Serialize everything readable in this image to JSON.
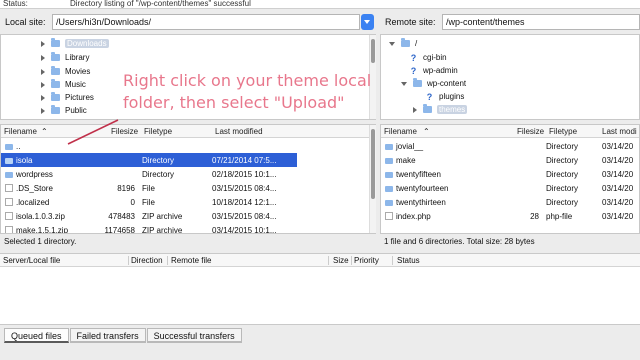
{
  "status": {
    "label": "Status:",
    "message": "Directory listing of \"/wp-content/themes\" successful"
  },
  "local": {
    "label": "Local site:",
    "path": "/Users/hi3n/Downloads/",
    "tree": [
      "Downloads",
      "Library",
      "Movies",
      "Music",
      "Pictures",
      "Public"
    ],
    "columns": [
      "Filename",
      "Filesize",
      "Filetype",
      "Last modified"
    ],
    "rows": [
      {
        "name": "..",
        "size": "",
        "type": "",
        "modified": "",
        "kind": "folder"
      },
      {
        "name": "isola",
        "size": "",
        "type": "Directory",
        "modified": "07/21/2014 07:5...",
        "kind": "folder",
        "selected": true
      },
      {
        "name": "wordpress",
        "size": "",
        "type": "Directory",
        "modified": "02/18/2015 10:1...",
        "kind": "folder"
      },
      {
        "name": ".DS_Store",
        "size": "8196",
        "type": "File",
        "modified": "03/15/2015 08:4...",
        "kind": "file"
      },
      {
        "name": ".localized",
        "size": "0",
        "type": "File",
        "modified": "10/18/2014 12:1...",
        "kind": "file"
      },
      {
        "name": "isola.1.0.3.zip",
        "size": "478483",
        "type": "ZIP archive",
        "modified": "03/15/2015 08:4...",
        "kind": "file"
      },
      {
        "name": "make.1.5.1.zip",
        "size": "1174658",
        "type": "ZIP archive",
        "modified": "03/14/2015 10:1...",
        "kind": "file"
      }
    ],
    "summary": "Selected 1 directory."
  },
  "remote": {
    "label": "Remote site:",
    "path": "/wp-content/themes",
    "tree": [
      "/",
      "cgi-bin",
      "wp-admin",
      "wp-content",
      "plugins",
      "themes"
    ],
    "columns": [
      "Filename",
      "Filesize",
      "Filetype",
      "Last modi"
    ],
    "rows": [
      {
        "name": "jovial__",
        "size": "",
        "type": "Directory",
        "modified": "03/14/20",
        "kind": "folder"
      },
      {
        "name": "make",
        "size": "",
        "type": "Directory",
        "modified": "03/14/20",
        "kind": "folder"
      },
      {
        "name": "twentyfifteen",
        "size": "",
        "type": "Directory",
        "modified": "03/14/20",
        "kind": "folder"
      },
      {
        "name": "twentyfourteen",
        "size": "",
        "type": "Directory",
        "modified": "03/14/20",
        "kind": "folder"
      },
      {
        "name": "twentythirteen",
        "size": "",
        "type": "Directory",
        "modified": "03/14/20",
        "kind": "folder"
      },
      {
        "name": "index.php",
        "size": "28",
        "type": "php-file",
        "modified": "03/14/20",
        "kind": "file"
      }
    ],
    "summary": "1 file and 6 directories. Total size: 28 bytes"
  },
  "queue_columns": [
    "Server/Local file",
    "Direction",
    "Remote file",
    "Size",
    "Priority",
    "Status"
  ],
  "tabs": [
    "Queued files",
    "Failed transfers",
    "Successful transfers"
  ],
  "annotation": "Right click on your theme local folder, then select  \"Upload\"",
  "colors": {
    "selection": "#2d5fd6",
    "annotation": "#e8778c",
    "dropdown": "#3b82f2"
  }
}
